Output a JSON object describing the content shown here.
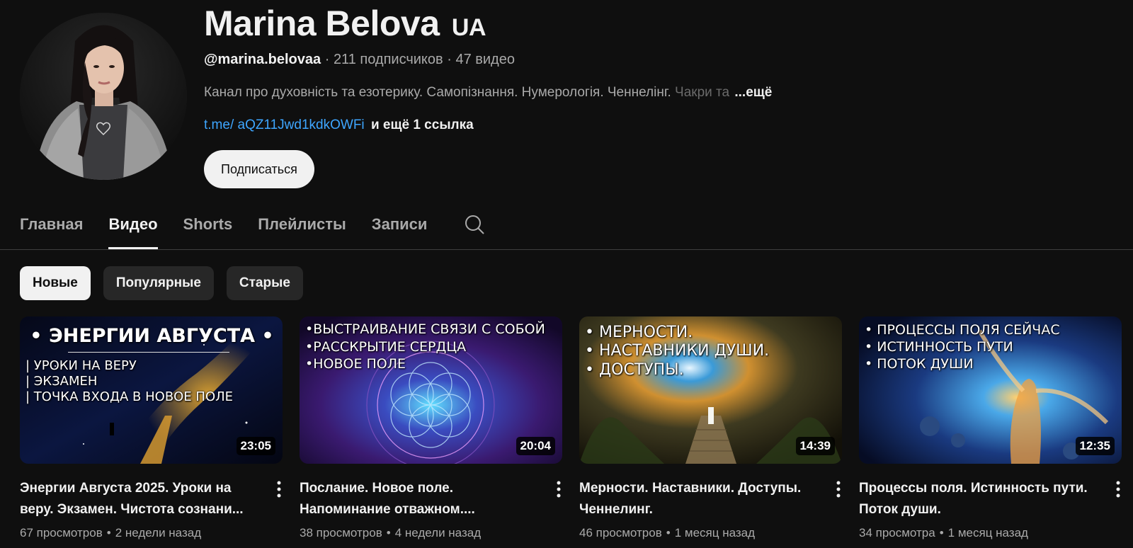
{
  "channel": {
    "name": "Marina Belova",
    "name_suffix": "UA",
    "handle": "@marina.belovaa",
    "subscribers": "211 подписчиков",
    "videos_count": "47 видео",
    "separator": "·",
    "description": "Канал про духовність та езотерику. Самопізнання. Нумерологія. Ченнелінг.",
    "description_fade": "Чакри та",
    "more_label": "...ещё",
    "link": "t.me/ aQZ11Jwd1kdkOWFi",
    "more_links": "и ещё 1 ссылка",
    "subscribe_label": "Подписаться"
  },
  "tabs": [
    {
      "label": "Главная",
      "active": false
    },
    {
      "label": "Видео",
      "active": true
    },
    {
      "label": "Shorts",
      "active": false
    },
    {
      "label": "Плейлисты",
      "active": false
    },
    {
      "label": "Записи",
      "active": false
    }
  ],
  "chips": [
    {
      "label": "Новые",
      "active": true
    },
    {
      "label": "Популярные",
      "active": false
    },
    {
      "label": "Старые",
      "active": false
    }
  ],
  "videos": [
    {
      "thumb_title": "• ЭНЕРГИИ АВГУСТА •",
      "thumb_lines": [
        "| УРОКИ НА ВЕРУ",
        "| ЭКЗАМЕН",
        "| ТОЧКА ВХОДА В НОВОЕ ПОЛЕ"
      ],
      "duration": "23:05",
      "title": "Энергии Августа 2025. Уроки на веру. Экзамен. Чистота сознани...",
      "views": "67 просмотров",
      "age": "2 недели назад"
    },
    {
      "thumb_lines": [
        "•ВЫСТРАИВАНИЕ СВЯЗИ С СОБОЙ",
        "•РАССКРЫТИЕ СЕРДЦА",
        "•НОВОЕ ПОЛЕ"
      ],
      "duration": "20:04",
      "title": "Послание. Новое поле. Напоминание отважном....",
      "views": "38 просмотров",
      "age": "4 недели назад"
    },
    {
      "thumb_lines": [
        "• МЕРНОСТИ.",
        "• НАСТАВНИКИ ДУШИ.",
        "• ДОСТУПЫ."
      ],
      "duration": "14:39",
      "title": "Мерности. Наставники. Доступы. Ченнелинг.",
      "views": "46 просмотров",
      "age": "1 месяц назад"
    },
    {
      "thumb_lines": [
        "• ПРОЦЕССЫ ПОЛЯ СЕЙЧАС",
        "• ИСТИННОСТЬ ПУТИ",
        "• ПОТОК ДУШИ"
      ],
      "duration": "12:35",
      "title": "Процессы поля. Истинность пути. Поток души.",
      "views": "34 просмотра",
      "age": "1 месяц назад"
    }
  ]
}
